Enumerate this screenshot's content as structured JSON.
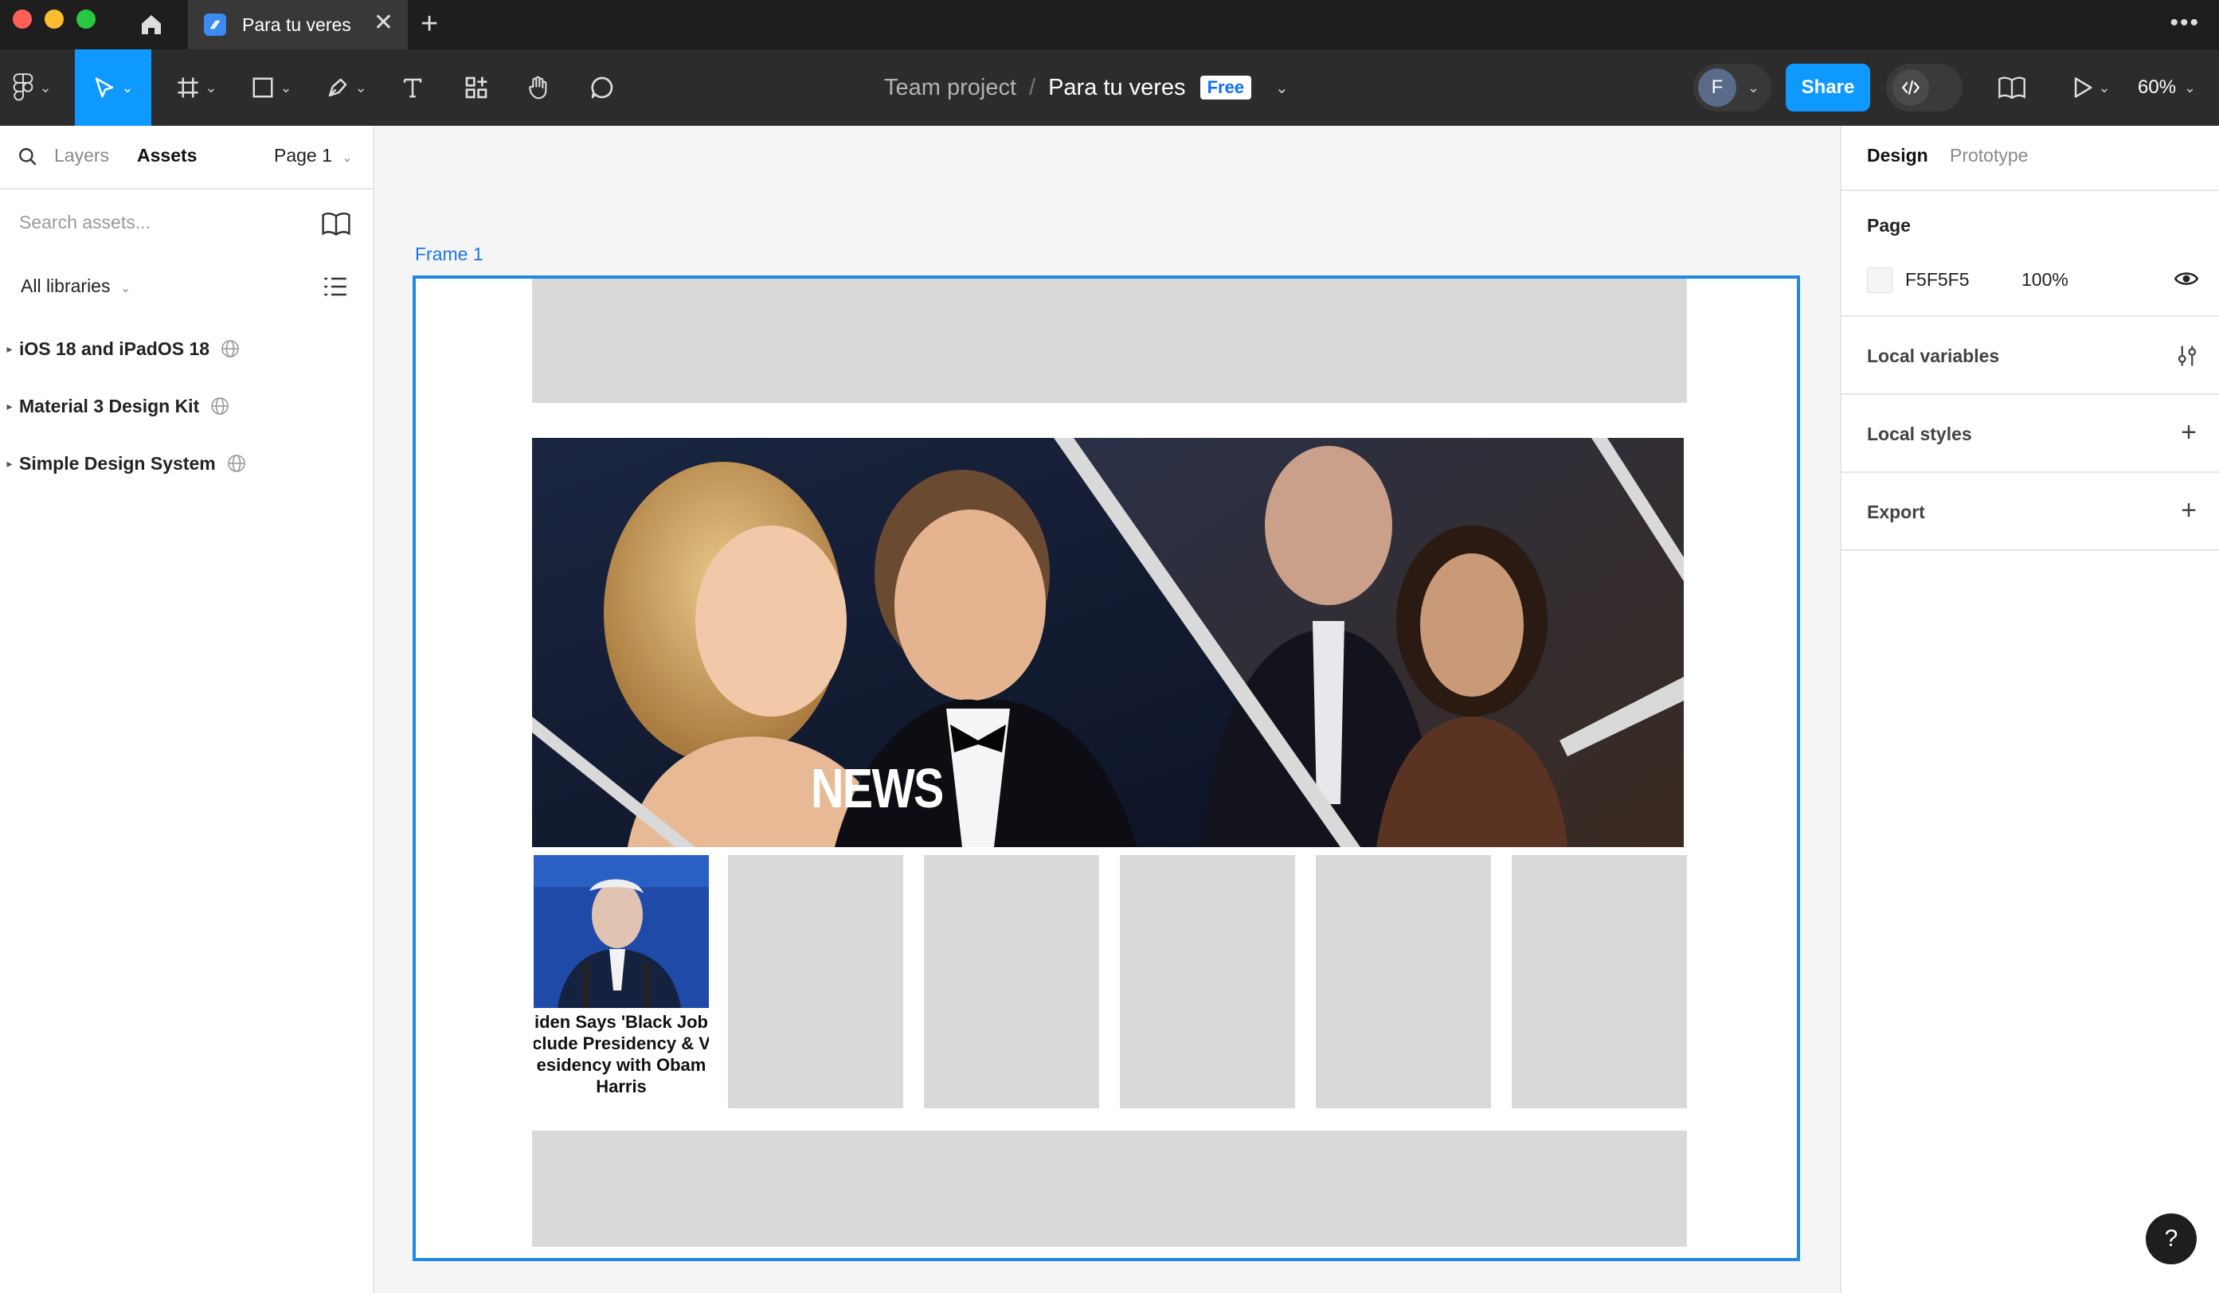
{
  "window": {
    "tab_title": "Para tu veres",
    "close_glyph": "✕",
    "new_tab_glyph": "+",
    "more_glyph": "•••"
  },
  "toolbar": {
    "tools": [
      "main-menu",
      "move",
      "frame",
      "shape",
      "pen",
      "text",
      "resources",
      "hand",
      "comment"
    ],
    "team_project": "Team project",
    "separator": "/",
    "file_name": "Para tu veres",
    "plan_badge": "Free",
    "avatar_initial": "F",
    "share_label": "Share",
    "zoom_level": "60%"
  },
  "left_panel": {
    "tabs": {
      "layers": "Layers",
      "assets": "Assets"
    },
    "page_selector": "Page 1",
    "search_placeholder": "Search assets...",
    "libraries_filter": "All libraries",
    "libraries": [
      {
        "name": "iOS 18 and iPadOS 18"
      },
      {
        "name": "Material 3 Design Kit"
      },
      {
        "name": "Simple Design System"
      }
    ]
  },
  "canvas": {
    "frame_name": "Frame 1",
    "hero_text": "NEWS",
    "headline_lines": [
      "iden Says 'Black Job",
      "clude Presidency & V",
      "esidency with Obam",
      "Harris"
    ]
  },
  "right_panel": {
    "tabs": {
      "design": "Design",
      "prototype": "Prototype"
    },
    "page_section": {
      "title": "Page",
      "color_hex": "F5F5F5",
      "opacity": "100%"
    },
    "local_variables": "Local variables",
    "local_styles": "Local styles",
    "export": "Export"
  },
  "help_glyph": "?",
  "colors": {
    "accent": "#0d99ff",
    "frame_border": "#1e88e5",
    "placeholder": "#d9d9d9",
    "canvas_bg": "#f5f5f5"
  }
}
